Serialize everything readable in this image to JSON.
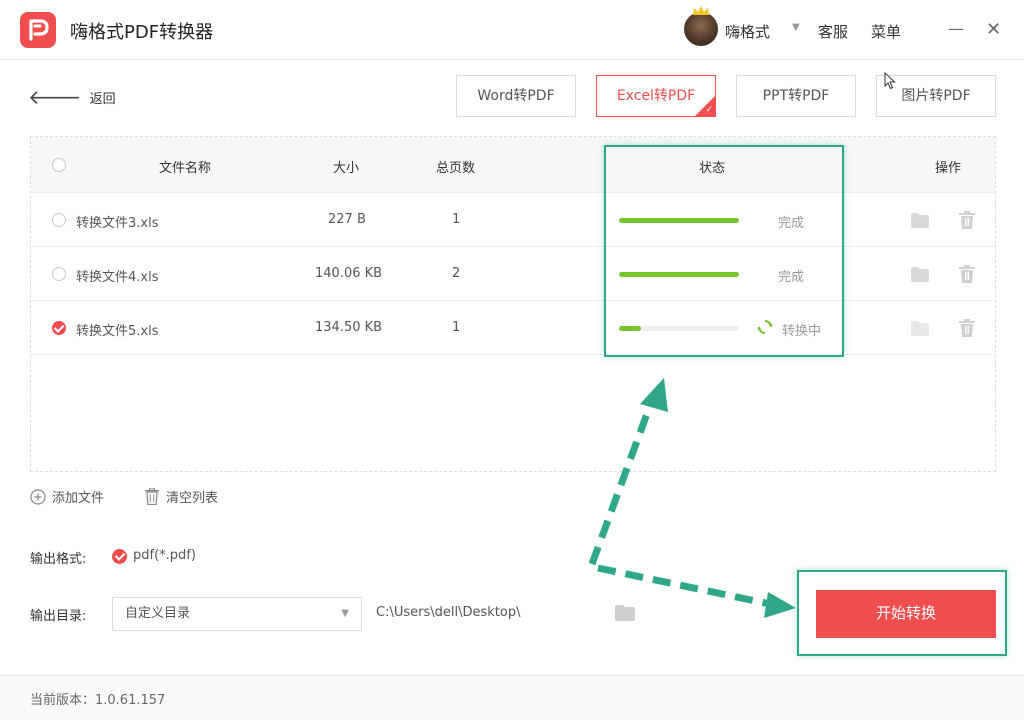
{
  "app": {
    "title": "嗨格式PDF转换器"
  },
  "user": {
    "name": "嗨格式"
  },
  "header": {
    "service": "客服",
    "menu": "菜单",
    "minimize": "—",
    "close": "✕"
  },
  "nav": {
    "back": "返回",
    "back_arrow": "🡐"
  },
  "convert_tabs": [
    {
      "label": "Word转PDF",
      "active": false
    },
    {
      "label": "Excel转PDF",
      "active": true
    },
    {
      "label": "PPT转PDF",
      "active": false
    },
    {
      "label": "图片转PDF",
      "active": false
    }
  ],
  "table": {
    "headers": {
      "name": "文件名称",
      "size": "大小",
      "pages": "总页数",
      "status": "状态",
      "actions": "操作"
    },
    "rows": [
      {
        "name": "转换文件3.xls",
        "size": "227 B",
        "pages": "1",
        "progress": 1.0,
        "status": "完成",
        "checked": false
      },
      {
        "name": "转换文件4.xls",
        "size": "140.06 KB",
        "pages": "2",
        "progress": 1.0,
        "status": "完成",
        "checked": false
      },
      {
        "name": "转换文件5.xls",
        "size": "134.50 KB",
        "pages": "1",
        "progress": 0.18,
        "status": "转换中",
        "checked": true
      }
    ]
  },
  "list_actions": {
    "add": "添加文件",
    "clear": "清空列表"
  },
  "output": {
    "format_label": "输出格式:",
    "format_value": "pdf(*.pdf)",
    "dir_label": "输出目录:",
    "dir_select": "自定义目录",
    "dir_path": "C:\\Users\\dell\\Desktop\\"
  },
  "start_button": "开始转换",
  "footer": {
    "version": "当前版本：1.0.61.157"
  },
  "colors": {
    "brand": "#f04e4e",
    "progress": "#72c62c",
    "annotation": "#2ea889"
  }
}
